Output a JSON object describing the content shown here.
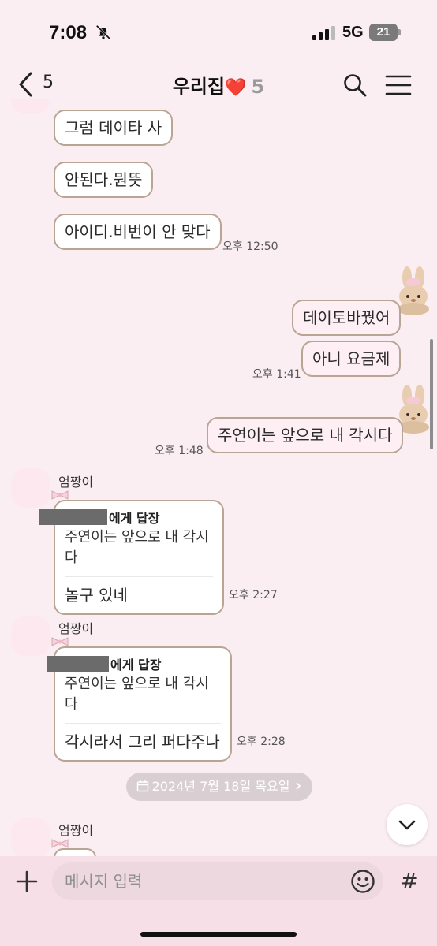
{
  "status_bar": {
    "time": "7:08",
    "network": "5G",
    "battery": "21",
    "icons": [
      "bell-off-icon",
      "signal-icon",
      "battery-icon"
    ]
  },
  "header": {
    "back_count": "5",
    "title": "우리집",
    "title_heart": "❤️",
    "member_count": "5",
    "icons": [
      "chevron-left-icon",
      "search-icon",
      "menu-icon"
    ]
  },
  "messages": {
    "m1": "그럼 데이타 사",
    "m2": "안된다.뭔뜻",
    "m3": "아이디.비번이 안 맞다",
    "m3_time": "오후 12:50",
    "m4": "데이토바꿨어",
    "m5": "아니 요금제",
    "m5_time": "오후 1:41",
    "m6": "주연이는 앞으로 내 각시다",
    "m6_time": "오후 1:48",
    "sender": "엄짱이",
    "r1_head": "에게 답장",
    "r1_quote": "주연이는 앞으로 내 각시다",
    "r1_msg": "놀구 있네",
    "r1_time": "오후 2:27",
    "r2_head": "에게 답장",
    "r2_quote": "주연이는 앞으로 내 각시다",
    "r2_msg": "각시라서  그리 퍼다주나",
    "r2_time": "오후 2:28",
    "date_divider": "2024년 7월 18일 목요일"
  },
  "input": {
    "placeholder": "메시지 입력",
    "hash": "#"
  },
  "colors": {
    "background": "#fbeef3",
    "bubble_border": "#b8a596",
    "heart": "#e3202f",
    "input_bar": "#f7dfe8"
  }
}
